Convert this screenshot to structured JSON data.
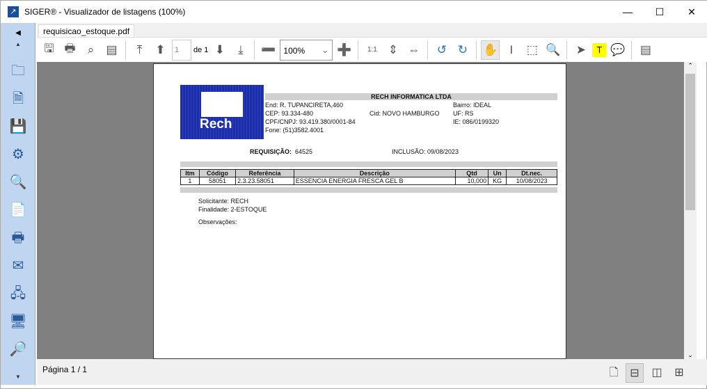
{
  "window": {
    "title": "SIGER® - Visualizador de listagens (100%)",
    "minimize": "—",
    "maximize": "☐",
    "close": "✕"
  },
  "tab": {
    "label": "requisicao_estoque.pdf"
  },
  "toolbar": {
    "page_value": "1",
    "page_of": "de 1",
    "zoom": "100%"
  },
  "document": {
    "company": "RECH INFORMATICA LTDA",
    "logo_text": "Rech",
    "address": "End: R. TUPANCIRETA,460",
    "bairro": "Bairro: IDEAL",
    "cep": "CEP: 93.334-480",
    "cidade": "Cid: NOVO HAMBURGO",
    "uf": "UF: RS",
    "cnpj": "CPF/CNPJ: 93.419.380/0001-84",
    "ie": "IE: 086/0199320",
    "fone": "Fone: (51)3582.4001",
    "requisicao_label": "REQUISIÇÃO:",
    "requisicao_value": "64525",
    "inclusao": "INCLUSÃO: 09/08/2023",
    "columns": [
      "Itm",
      "Código",
      "Referência",
      "Descrição",
      "Qtd",
      "Un",
      "Dt.nec."
    ],
    "rows": [
      [
        "1",
        "58051",
        "2.3.23.58051",
        "ESSENCIA ENERGIA FRESCA GEL B",
        "10,000",
        "KG",
        "10/08/2023"
      ]
    ],
    "solicitante": "Solicitante:  RECH",
    "finalidade": "Finalidade:  2-ESTOQUE",
    "observacoes": "Observações:"
  },
  "status": {
    "page": "Página 1 / 1"
  }
}
